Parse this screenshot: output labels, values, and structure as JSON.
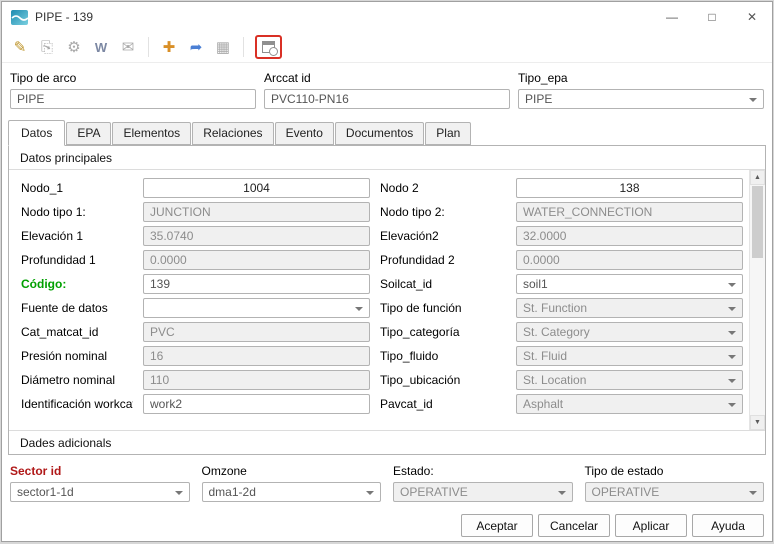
{
  "window": {
    "title": "PIPE - 139",
    "controls": {
      "minimize": "—",
      "maximize": "□",
      "close": "✕"
    }
  },
  "toolbar": {
    "icons": [
      {
        "name": "edit-icon",
        "glyph": "✎"
      },
      {
        "name": "copy-icon",
        "glyph": "⎘"
      },
      {
        "name": "settings-icon",
        "glyph": "⚙"
      },
      {
        "name": "word-export-icon",
        "glyph": "W"
      },
      {
        "name": "mail-icon",
        "glyph": "✉"
      },
      {
        "name": "add-element-icon",
        "glyph": "✚"
      },
      {
        "name": "forward-icon",
        "glyph": "➦"
      },
      {
        "name": "image-icon",
        "glyph": "▦"
      },
      {
        "name": "date-picker-icon",
        "glyph": ""
      }
    ]
  },
  "header_fields": [
    {
      "label": "Tipo de arco",
      "value": "PIPE"
    },
    {
      "label": "Arccat id",
      "value": "PVC110-PN16"
    },
    {
      "label": "Tipo_epa",
      "value": "PIPE"
    }
  ],
  "tabs": [
    "Datos",
    "EPA",
    "Elementos",
    "Relaciones",
    "Evento",
    "Documentos",
    "Plan"
  ],
  "sections": {
    "main": "Datos principales",
    "additional": "Dades adicionals"
  },
  "form": {
    "left": [
      {
        "label": "Nodo_1",
        "value": "1004"
      },
      {
        "label": "Nodo tipo 1:",
        "value": "JUNCTION"
      },
      {
        "label": "Elevación 1",
        "value": "35.0740"
      },
      {
        "label": "Profundidad 1",
        "value": "0.0000"
      },
      {
        "label": "Código:",
        "value": "139"
      },
      {
        "label": "Fuente de datos",
        "value": ""
      },
      {
        "label": "Cat_matcat_id",
        "value": "PVC"
      },
      {
        "label": "Presión nominal",
        "value": "16"
      },
      {
        "label": "Diámetro nominal",
        "value": "110"
      },
      {
        "label": "Identificación workcat",
        "value": "work2"
      }
    ],
    "right": [
      {
        "label": "Nodo 2",
        "value": "138"
      },
      {
        "label": "Nodo tipo 2:",
        "value": "WATER_CONNECTION"
      },
      {
        "label": "Elevación2",
        "value": "32.0000"
      },
      {
        "label": "Profundidad 2",
        "value": "0.0000"
      },
      {
        "label": "Soilcat_id",
        "value": "soil1"
      },
      {
        "label": "Tipo de función",
        "value": "St. Function"
      },
      {
        "label": "Tipo_categoría",
        "value": "St. Category"
      },
      {
        "label": "Tipo_fluido",
        "value": "St. Fluid"
      },
      {
        "label": "Tipo_ubicación",
        "value": "St. Location"
      },
      {
        "label": "Pavcat_id",
        "value": "Asphalt"
      }
    ]
  },
  "bottom_fields": [
    {
      "label": "Sector id",
      "value": "sector1-1d"
    },
    {
      "label": "Omzone",
      "value": "dma1-2d"
    },
    {
      "label": "Estado:",
      "value": "OPERATIVE"
    },
    {
      "label": "Tipo de estado",
      "value": "OPERATIVE"
    }
  ],
  "buttons": [
    "Aceptar",
    "Cancelar",
    "Aplicar",
    "Ayuda"
  ],
  "colors": {
    "accent_green": "#00a000",
    "accent_red": "#b01818",
    "highlight_red": "#d93025"
  }
}
